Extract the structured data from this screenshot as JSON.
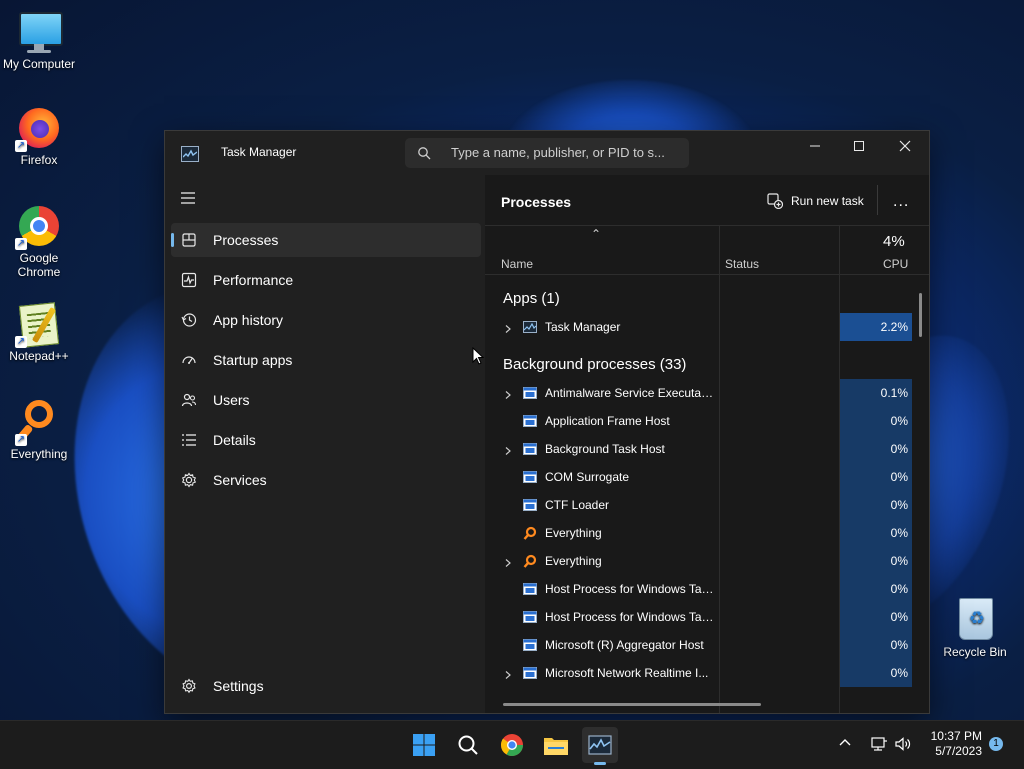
{
  "desktop": {
    "icons": [
      {
        "label": "My Computer"
      },
      {
        "label": "Firefox"
      },
      {
        "label": "Google Chrome"
      },
      {
        "label": "Notepad++"
      },
      {
        "label": "Everything"
      },
      {
        "label": "Recycle Bin"
      }
    ]
  },
  "window": {
    "title": "Task Manager",
    "search_placeholder": "Type a name, publisher, or PID to s...",
    "controls": [
      "minimize",
      "maximize",
      "close"
    ]
  },
  "sidebar": {
    "items": [
      {
        "label": "Processes",
        "icon": "processes-icon",
        "active": true
      },
      {
        "label": "Performance",
        "icon": "performance-icon"
      },
      {
        "label": "App history",
        "icon": "app-history-icon"
      },
      {
        "label": "Startup apps",
        "icon": "startup-apps-icon"
      },
      {
        "label": "Users",
        "icon": "users-icon"
      },
      {
        "label": "Details",
        "icon": "details-icon"
      },
      {
        "label": "Services",
        "icon": "services-icon"
      }
    ],
    "settings_label": "Settings"
  },
  "main": {
    "title": "Processes",
    "run_new_task": "Run new task",
    "more": "...",
    "columns": {
      "name": "Name",
      "status": "Status",
      "cpu": "CPU",
      "cpu_total": "4%"
    },
    "groups": {
      "apps": "Apps (1)",
      "background": "Background processes (33)"
    },
    "apps": [
      {
        "name": "Task Manager",
        "cpu": "2.2%",
        "expandable": true,
        "icon": "task-manager-icon"
      }
    ],
    "background": [
      {
        "name": "Antimalware Service Executable",
        "cpu": "0.1%",
        "expandable": true,
        "icon": "app-window-icon"
      },
      {
        "name": "Application Frame Host",
        "cpu": "0%",
        "expandable": false,
        "icon": "app-window-icon"
      },
      {
        "name": "Background Task Host",
        "cpu": "0%",
        "expandable": true,
        "icon": "app-window-icon"
      },
      {
        "name": "COM Surrogate",
        "cpu": "0%",
        "expandable": false,
        "icon": "app-window-icon"
      },
      {
        "name": "CTF Loader",
        "cpu": "0%",
        "expandable": false,
        "icon": "app-window-icon"
      },
      {
        "name": "Everything",
        "cpu": "0%",
        "expandable": false,
        "icon": "everything-icon"
      },
      {
        "name": "Everything",
        "cpu": "0%",
        "expandable": true,
        "icon": "everything-icon"
      },
      {
        "name": "Host Process for Windows Tasks",
        "cpu": "0%",
        "expandable": false,
        "icon": "app-window-icon"
      },
      {
        "name": "Host Process for Windows Tasks",
        "cpu": "0%",
        "expandable": false,
        "icon": "app-window-icon"
      },
      {
        "name": "Microsoft (R) Aggregator Host",
        "cpu": "0%",
        "expandable": false,
        "icon": "app-window-icon"
      },
      {
        "name": "Microsoft Network Realtime I...",
        "cpu": "0%",
        "expandable": true,
        "icon": "app-window-icon"
      }
    ]
  },
  "taskbar": {
    "clock_time": "10:37 PM",
    "clock_date": "5/7/2023",
    "notification_count": "1"
  },
  "colors": {
    "accent": "#76b9ed",
    "cpu_heat_high": "#1b4f93",
    "cpu_heat_low": "#173a66",
    "window_bg": "#202020"
  }
}
